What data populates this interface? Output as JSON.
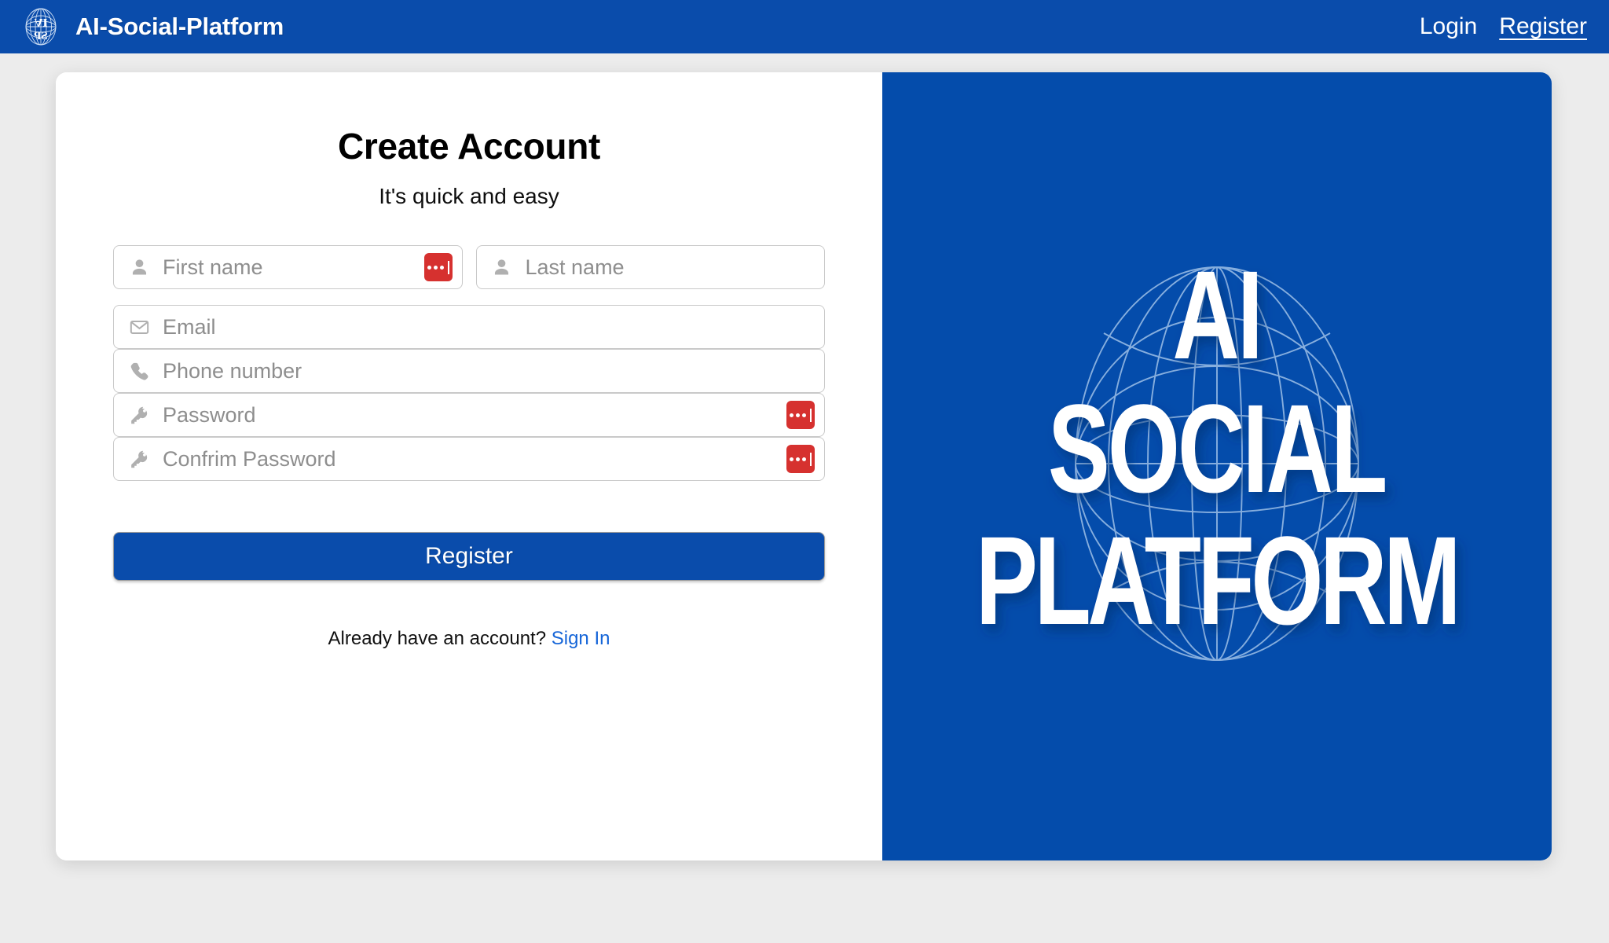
{
  "header": {
    "logo_icon": "globe-ai-sp-logo",
    "brand_title": "AI-Social-Platform",
    "nav": [
      {
        "label": "Login",
        "active": false
      },
      {
        "label": "Register",
        "active": true
      }
    ]
  },
  "colors": {
    "brand_blue": "#0a4cab",
    "panel_blue": "#044cab",
    "page_background": "#ececec",
    "card_background": "#ffffff",
    "password_manager_red": "#d6312f",
    "link_blue": "#1565d8",
    "placeholder_gray": "#8e8e8e",
    "field_border": "#c9c9c9"
  },
  "form": {
    "title": "Create Account",
    "subtitle": "It's quick and easy",
    "fields": [
      {
        "name": "first-name",
        "placeholder": "First name",
        "icon": "person-icon",
        "password_manager": true
      },
      {
        "name": "last-name",
        "placeholder": "Last name",
        "icon": "person-icon",
        "password_manager": false
      },
      {
        "name": "email",
        "placeholder": "Email",
        "icon": "envelope-icon",
        "password_manager": false
      },
      {
        "name": "phone",
        "placeholder": "Phone number",
        "icon": "phone-icon",
        "password_manager": false
      },
      {
        "name": "password",
        "placeholder": "Password",
        "icon": "key-icon",
        "password_manager": true
      },
      {
        "name": "confirm-password",
        "placeholder": "Confrim Password",
        "icon": "key-icon",
        "password_manager": true
      }
    ],
    "submit_label": "Register",
    "footer_text": "Already have an account?",
    "footer_link": "Sign In"
  },
  "brand_panel": {
    "icon": "wireframe-globe-icon",
    "line1": "AI",
    "line2": "SOCIAL",
    "line3": "PLATFORM"
  }
}
